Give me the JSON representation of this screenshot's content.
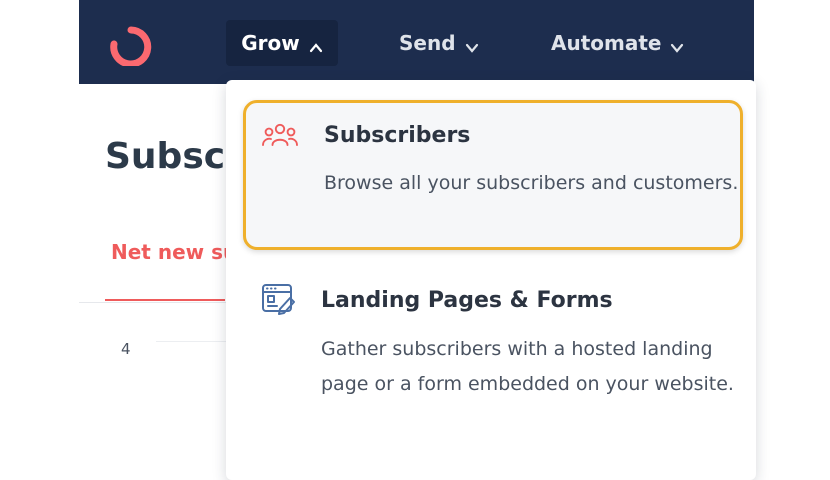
{
  "nav": {
    "items": [
      {
        "label": "Grow",
        "icon": "chevron-up-icon"
      },
      {
        "label": "Send",
        "icon": "chevron-down-icon"
      },
      {
        "label": "Automate",
        "icon": "chevron-down-icon"
      }
    ]
  },
  "page": {
    "title": "Subscri",
    "tab_label": "Net new su",
    "axis_tick": "4"
  },
  "dropdown": {
    "items": [
      {
        "title": "Subscribers",
        "description": "Browse all your subscribers and customers.",
        "icon": "people-icon",
        "highlighted": true
      },
      {
        "title": "Landing Pages & Forms",
        "description": "Gather subscribers with a hosted landing page or a form embedded on your website.",
        "icon": "form-edit-icon"
      }
    ]
  },
  "colors": {
    "nav_bg": "#1d2d4e",
    "accent": "#ef5b5b",
    "highlight_border": "#efb02c",
    "icon_blue": "#4a6fa5"
  }
}
